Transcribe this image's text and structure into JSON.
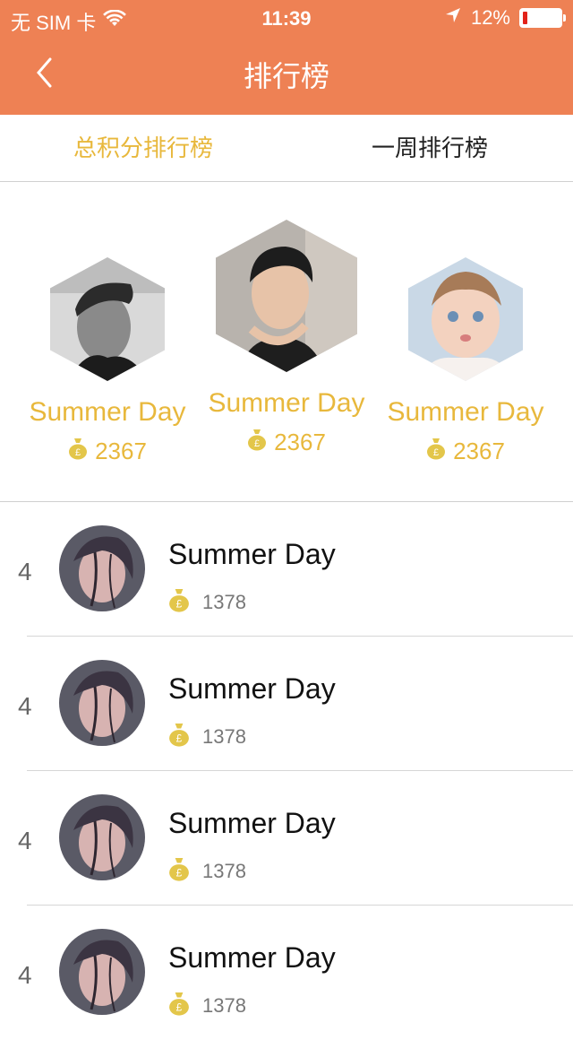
{
  "status": {
    "carrier": "无 SIM 卡",
    "time": "11:39",
    "battery": "12%",
    "battery_level": 0.12
  },
  "nav": {
    "title": "排行榜",
    "back_icon": "back-chevron-icon"
  },
  "tabs": [
    {
      "label": "总积分排行榜",
      "active": true
    },
    {
      "label": "一周排行榜",
      "active": false
    }
  ],
  "podium": [
    {
      "name": "Summer Day",
      "score": "2367"
    },
    {
      "name": "Summer Day",
      "score": "2367"
    },
    {
      "name": "Summer Day",
      "score": "2367"
    }
  ],
  "list": [
    {
      "rank": "4",
      "name": "Summer Day",
      "score": "1378"
    },
    {
      "rank": "4",
      "name": "Summer Day",
      "score": "1378"
    },
    {
      "rank": "4",
      "name": "Summer Day",
      "score": "1378"
    },
    {
      "rank": "4",
      "name": "Summer Day",
      "score": "1378"
    }
  ],
  "colors": {
    "nav_bg": "#ee8154",
    "accent": "#e8b83c",
    "coin": "#e3c64a"
  }
}
